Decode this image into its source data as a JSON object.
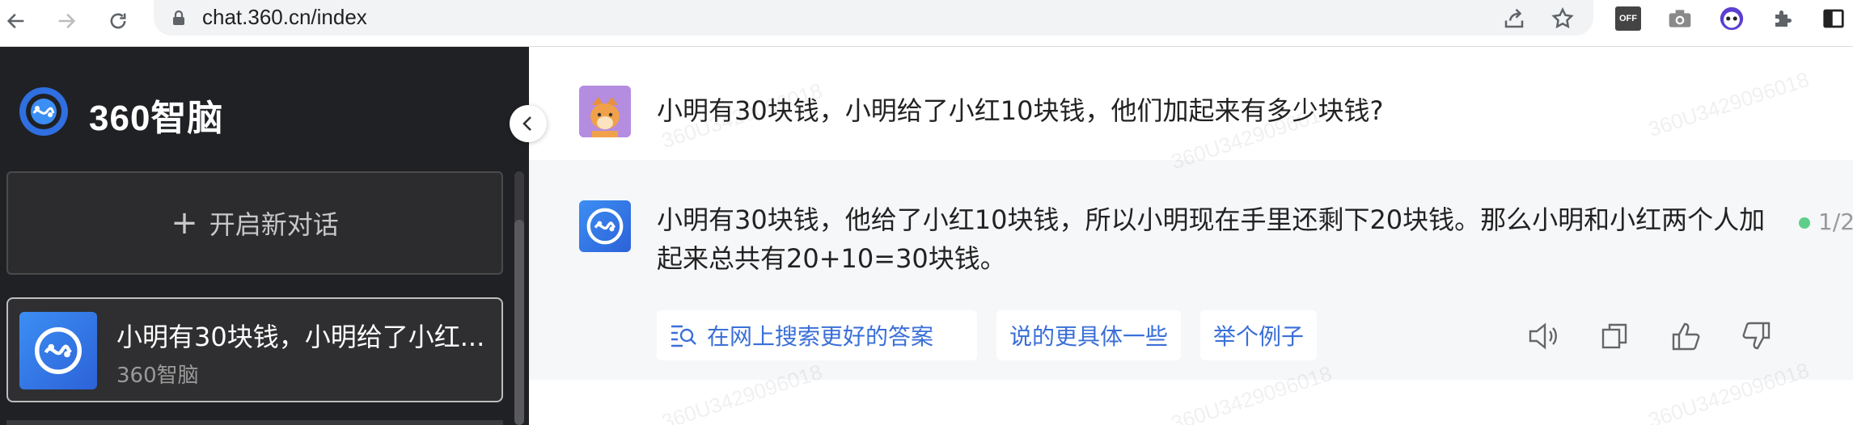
{
  "browser": {
    "url": "chat.360.cn/index",
    "extension_badge": "OFF",
    "icons": {
      "back": "arrow-left-icon",
      "forward": "arrow-right-icon",
      "reload": "reload-icon",
      "lock": "lock-icon",
      "share": "share-icon",
      "bookmark": "star-icon",
      "camera": "camera-icon",
      "extension_face": "mask-face-icon",
      "extensions": "puzzle-icon",
      "sidepanel": "side-panel-icon"
    }
  },
  "sidebar": {
    "brand": "360智脑",
    "new_chat_label": "开启新对话",
    "conversations": [
      {
        "title": "小明有30块钱，小明给了小红...",
        "subtitle": "360智脑"
      }
    ]
  },
  "chat": {
    "user_message": "小明有30块钱，小明给了小红10块钱，他们加起来有多少块钱?",
    "ai_message": "小明有30块钱，他给了小红10块钱，所以小明现在手里还剩下20块钱。那么小明和小红两个人加起来总共有20+10=30块钱。",
    "answer_index": "1/2",
    "suggestions": {
      "search": "在网上搜索更好的答案",
      "more_specific": "说的更具体一些",
      "example": "举个例子"
    },
    "watermark": "360U3429096018"
  },
  "colors": {
    "sidebar_bg": "#202124",
    "accent": "#3a6fd8",
    "ai_row_bg": "#f6f7f9",
    "status_dot": "#5ecf8a"
  }
}
